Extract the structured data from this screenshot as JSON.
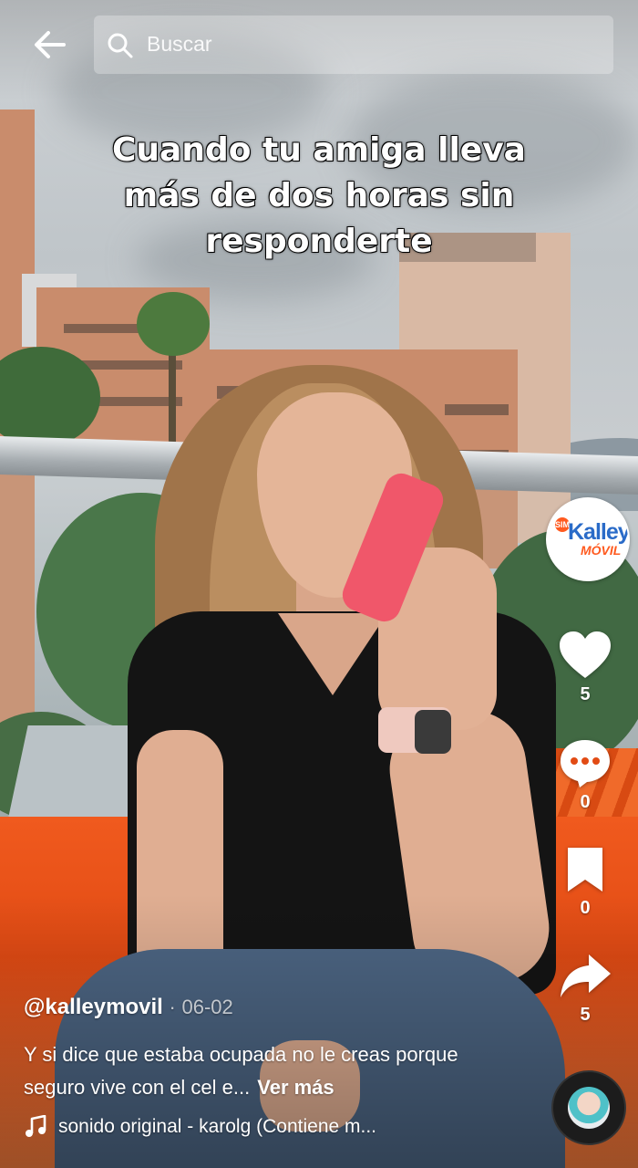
{
  "header": {
    "back_icon": "arrow-left-icon",
    "search_placeholder": "Buscar",
    "search_icon": "search-icon"
  },
  "video": {
    "caption": "Cuando tu amiga lleva más de dos horas sin responderte"
  },
  "brand_avatar": {
    "badge": "SIM",
    "name_top": "Kalley",
    "name_bottom": "MÓVIL"
  },
  "actions": {
    "likes": "5",
    "comments": "0",
    "saves": "0",
    "shares": "5"
  },
  "post": {
    "author": "@kalleymovil",
    "separator": "·",
    "date": "06-02",
    "description": "Y si dice que estaba ocupada no le creas porque seguro vive con el cel e...",
    "more_label": "Ver más",
    "sound": "sonido original - karolg (Contiene m..."
  }
}
